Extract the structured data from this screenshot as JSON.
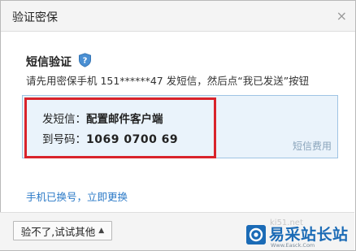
{
  "dialog": {
    "title": "验证密保",
    "close_glyph": "×"
  },
  "sms": {
    "heading": "短信验证",
    "instruction": "请先用密保手机 151******47 发短信，然后点“我已发送”按钮",
    "content_label": "发短信：",
    "content_value": "配置邮件客户端",
    "number_label": "到号码：",
    "number_value": "1069 0700 69",
    "fee_hint": "短信费用"
  },
  "links": {
    "change_phone": "手机已换号，立即更换"
  },
  "footer": {
    "other_button_label": "验不了,试试其他",
    "other_button_caret": "▲"
  },
  "watermark": {
    "partial_text": "ki51.net",
    "logo_text": "易采站长站",
    "logo_url": "Www.Easck.Com"
  },
  "colors": {
    "accent": "#2a79c7",
    "highlight_frame": "#d9232b",
    "sms_box_bg": "#eaf3fb",
    "logo_blue": "#1b6bb6"
  },
  "icons": {
    "section_icon": "shield-question-icon",
    "close_icon": "close-icon",
    "caret_icon": "caret-up-icon"
  }
}
